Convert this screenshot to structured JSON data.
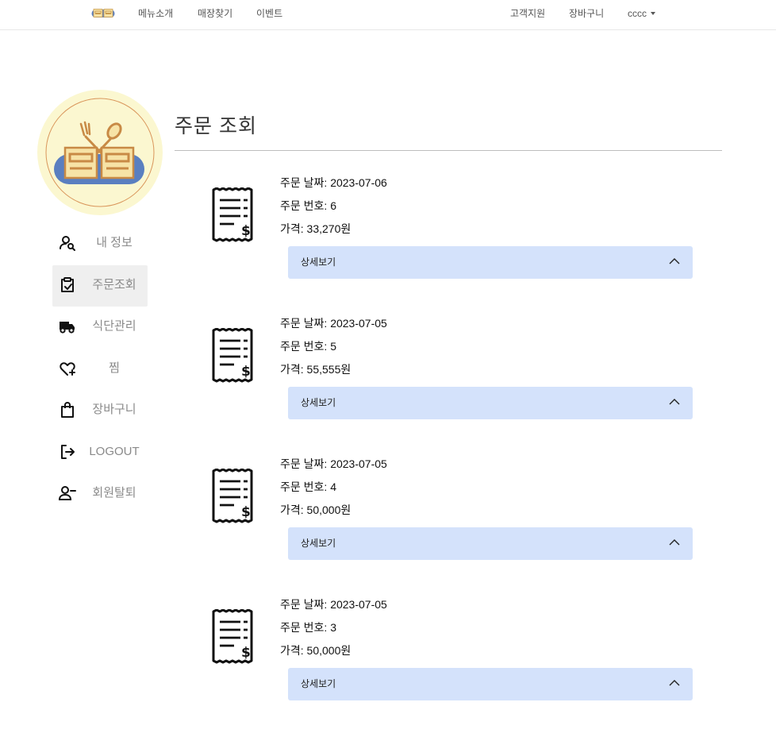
{
  "nav": {
    "logo": "logo-badge",
    "links": [
      {
        "label": "메뉴소개"
      },
      {
        "label": "매장찾기"
      },
      {
        "label": "이벤트"
      },
      {
        "label": "고객지원"
      },
      {
        "label": "장바구니"
      }
    ],
    "user": "cccc"
  },
  "sidebar": {
    "items": [
      {
        "label": "내 정보",
        "icon": "user-search-icon",
        "active": false
      },
      {
        "label": "주문조회",
        "icon": "clipboard-check-icon",
        "active": true
      },
      {
        "label": "식단관리",
        "icon": "truck-icon",
        "active": false
      },
      {
        "label": "찜",
        "icon": "heart-plus-icon",
        "active": false
      },
      {
        "label": "장바구니",
        "icon": "shopping-bag-icon",
        "active": false
      },
      {
        "label": "LOGOUT",
        "icon": "logout-icon",
        "active": false
      },
      {
        "label": "회원탈퇴",
        "icon": "user-minus-icon",
        "active": false
      }
    ]
  },
  "main": {
    "title": "주문 조회",
    "orders": [
      {
        "date": "주문 날짜: 2023-07-06",
        "number": "주문 번호: 6",
        "price": "가격: 33,270원",
        "detail_label": "상세보기"
      },
      {
        "date": "주문 날짜: 2023-07-05",
        "number": "주문 번호: 5",
        "price": "가격: 55,555원",
        "detail_label": "상세보기"
      },
      {
        "date": "주문 날짜: 2023-07-05",
        "number": "주문 번호: 4",
        "price": "가격: 50,000원",
        "detail_label": "상세보기"
      },
      {
        "date": "주문 날짜: 2023-07-05",
        "number": "주문 번호: 3",
        "price": "가격: 50,000원",
        "detail_label": "상세보기"
      }
    ]
  },
  "colors": {
    "accordion_bg": "#d4e2fb",
    "active_item_bg": "#efefef",
    "logo_circle": "#fbf7d0",
    "logo_blue": "#5a7fc0",
    "logo_cream": "#f7e3a6"
  }
}
